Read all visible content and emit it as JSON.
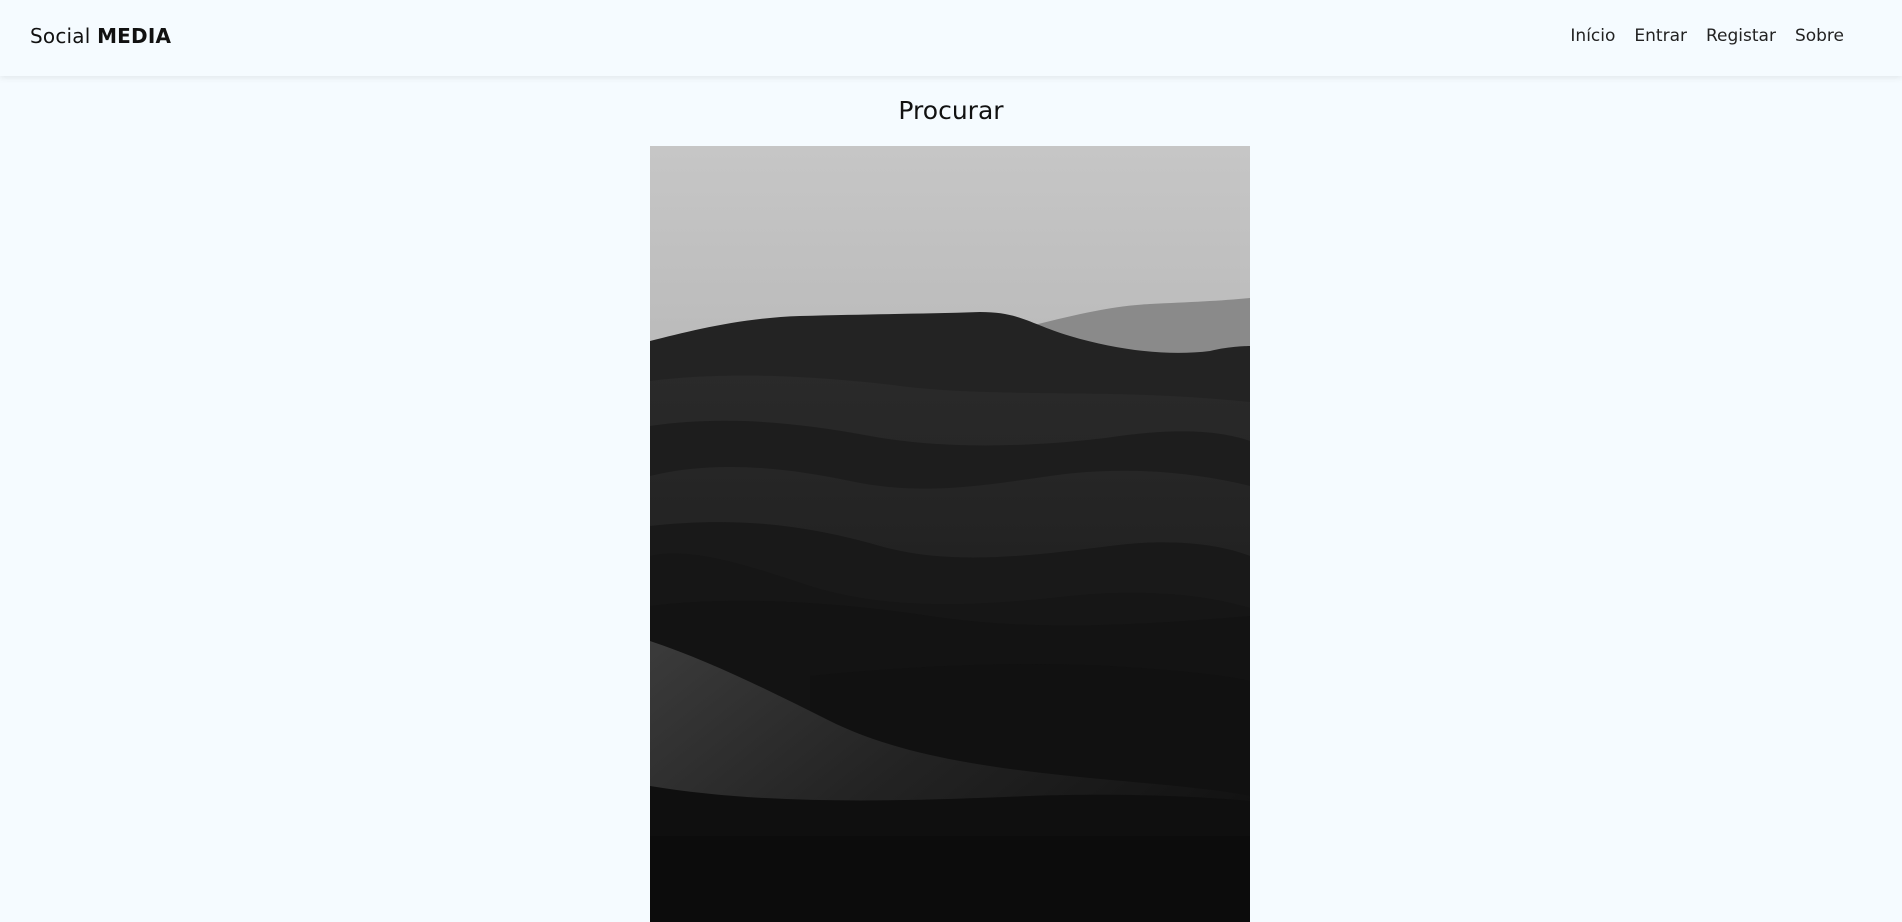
{
  "brand": {
    "light_part": "Social",
    "strong_part": "MEDIA"
  },
  "nav": {
    "items": [
      {
        "label": "Início",
        "id": "inicio"
      },
      {
        "label": "Entrar",
        "id": "entrar"
      },
      {
        "label": "Registar",
        "id": "registar"
      },
      {
        "label": "Sobre",
        "id": "sobre"
      }
    ]
  },
  "main": {
    "title": "Procurar"
  },
  "colors": {
    "background": "#f5fbff",
    "text": "#111111",
    "photo_dark": "#0c0c0c"
  },
  "photo": {
    "icon": "photo-desert-dunes-bw"
  }
}
